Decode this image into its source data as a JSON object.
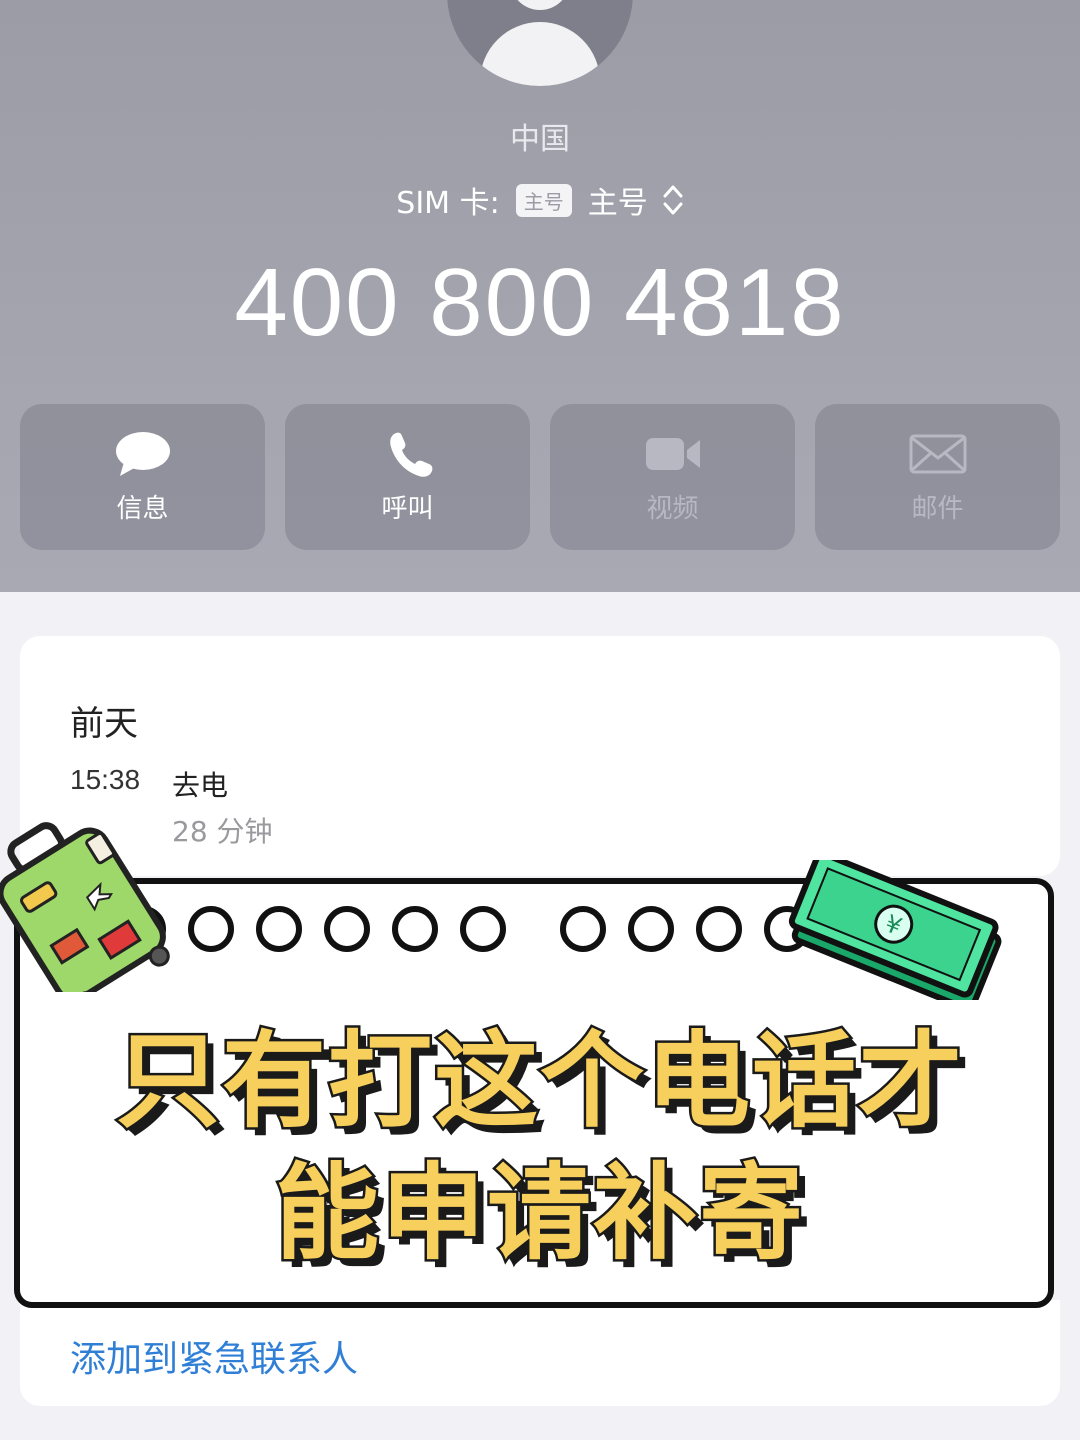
{
  "contact": {
    "country": "中国",
    "sim_label": "SIM 卡:",
    "sim_badge": "主号",
    "sim_value": "主号",
    "sim_toggle": "⌃⌄",
    "phone_number": "400 800 4818"
  },
  "actions": [
    {
      "label": "信息",
      "icon": "message-icon",
      "enabled": true
    },
    {
      "label": "呼叫",
      "icon": "phone-icon",
      "enabled": true
    },
    {
      "label": "视频",
      "icon": "video-icon",
      "enabled": false
    },
    {
      "label": "邮件",
      "icon": "mail-icon",
      "enabled": false
    }
  ],
  "history": {
    "date": "前天",
    "time": "15:38",
    "type": "去电",
    "duration": "28 分钟"
  },
  "emergency_link": "添加到紧急联系人",
  "banner": {
    "line1": "只有打这个电话才",
    "line2": "能申请补寄"
  },
  "colors": {
    "header_bg": "#a6a6b0",
    "link_blue": "#2f7fd6",
    "headline_yellow": "#f6cf5c"
  }
}
